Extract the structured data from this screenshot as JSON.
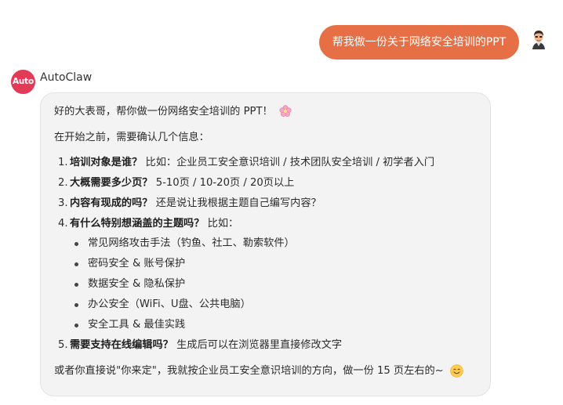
{
  "user_message": {
    "text": "帮我做一份关于网络安全培训的PPT",
    "avatar_icon": "user-avatar-icon"
  },
  "assistant": {
    "avatar_text": "Auto",
    "name": "AutoClaw",
    "accent_color": "#e23b58"
  },
  "reply": {
    "greeting": "好的大表哥，帮你做一份网络安全培训的 PPT！",
    "greeting_emoji": "cherry-blossom-icon",
    "confirm_intro": "在开始之前，需要确认几个信息：",
    "questions": [
      {
        "num": "1.",
        "title": "培训对象是谁？",
        "detail": "比如：企业员工安全意识培训 / 技术团队安全培训 / 初学者入门"
      },
      {
        "num": "2.",
        "title": "大概需要多少页？",
        "detail": "5-10页 / 10-20页 / 20页以上"
      },
      {
        "num": "3.",
        "title": "内容有现成的吗？",
        "detail": "还是说让我根据主题自己编写内容？"
      },
      {
        "num": "4.",
        "title": "有什么特别想涵盖的主题吗？",
        "detail": "比如："
      },
      {
        "num": "5.",
        "title": "需要支持在线编辑吗？",
        "detail": "生成后可以在浏览器里直接修改文字"
      }
    ],
    "topics": [
      "常见网络攻击手法（钓鱼、社工、勒索软件）",
      "密码安全 & 账号保护",
      "数据安全 & 隐私保护",
      "办公安全（WiFi、U盘、公共电脑）",
      "安全工具 & 最佳实践"
    ],
    "closing": "或者你直接说\"你来定\"，我就按企业员工安全意识培训的方向，做一份 15 页左右的~",
    "closing_emoji": "smiling-face-icon"
  },
  "colors": {
    "user_bubble": "#e66f45",
    "assistant_bubble": "#f3f3f3"
  }
}
